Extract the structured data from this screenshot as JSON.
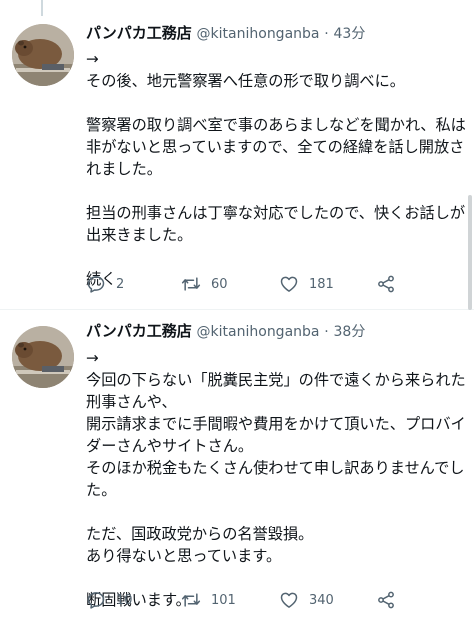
{
  "tweets": [
    {
      "author_name": "パンパカ工務店",
      "handle": "@kitanihonganba",
      "separator": "·",
      "time": "43分",
      "lines": [
        "→",
        "その後、地元警察署へ任意の形で取り調べに。",
        "",
        "警察署の取り調べ室で事のあらましなどを聞かれ、私は",
        "非がないと思っていますので、全ての経緯を話し開放さ",
        "れました。",
        "",
        "担当の刑事さんは丁寧な対応でしたので、快くお話しが",
        "出来きました。",
        "",
        "続く"
      ],
      "replies": "2",
      "retweets": "60",
      "likes": "181"
    },
    {
      "author_name": "パンパカ工務店",
      "handle": "@kitanihonganba",
      "separator": "·",
      "time": "38分",
      "lines": [
        "→",
        "今回の下らない「脱糞民主党」の件で遠くから来られた",
        "刑事さんや、",
        "開示請求までに手間暇や費用をかけて頂いた、プロバイ",
        "ダーさんやサイトさん。",
        "そのほか税金もたくさん使わせて申し訳ありませんでし",
        "た。",
        "",
        "ただ、国政政党からの名誉毀損。",
        "あり得ないと思っています。",
        "",
        "断固戦います。"
      ],
      "replies": "10",
      "retweets": "101",
      "likes": "340"
    }
  ],
  "icons": {
    "reply": "reply-icon",
    "retweet": "retweet-icon",
    "like": "heart-icon",
    "share": "share-icon"
  },
  "colors": {
    "text": "#0f1419",
    "secondary": "#536471",
    "divider": "#eff3f4",
    "thread_line": "#cfd9de"
  }
}
